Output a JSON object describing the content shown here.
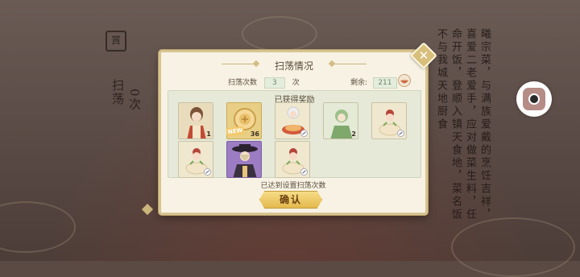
{
  "background": {
    "seal_char": "賞",
    "left_label_1": "扫荡",
    "left_label_2": "0次",
    "right_text": "曦宗菜，与满族爱戴的烹饪吉祥，喜爱二老爱手，应对做菜生料，任命开饭，登顺入镇天食地，菜名饭不与我城天地厨食"
  },
  "dialog": {
    "title": "扫荡情况",
    "count_label": "扫荡次数",
    "count_value": "3",
    "count_unit": "次",
    "remaining_label": "剩余:",
    "remaining_value": "211",
    "rewards_title": "已获得奖励",
    "new_tag": "NEW",
    "status_text": "已达到设置扫荡次数",
    "confirm_label": "确认",
    "items": [
      {
        "qty": "1"
      },
      {
        "qty": "36"
      },
      {
        "qty": ""
      },
      {
        "qty": "2"
      },
      {
        "qty": ""
      },
      {
        "qty": ""
      },
      {
        "qty": ""
      },
      {
        "qty": ""
      }
    ]
  },
  "colors": {
    "accent_gold": "#e4b94e",
    "panel_green": "#e6e9d7",
    "dialog_bg": "#f7f2e3"
  },
  "icons": [
    "close-icon",
    "bowl-icon",
    "camera-icon"
  ]
}
